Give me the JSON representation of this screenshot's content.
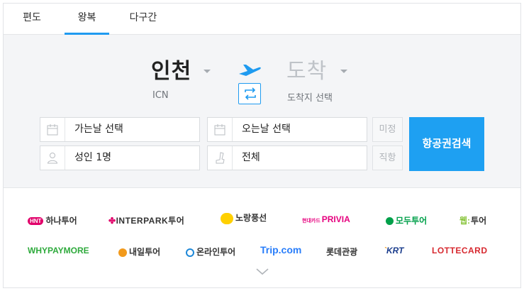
{
  "tabs": [
    {
      "label": "편도"
    },
    {
      "label": "왕복"
    },
    {
      "label": "다구간"
    }
  ],
  "active_tab": "왕복",
  "origin": {
    "name": "인천",
    "code": "ICN"
  },
  "destination": {
    "name": "도착",
    "code": "도착지 선택"
  },
  "fields": {
    "depart_date": "가는날 선택",
    "return_date": "오는날 선택",
    "flex_label": "미정",
    "passengers": "성인 1명",
    "seat_class": "전체",
    "direct_label": "직항"
  },
  "search_button": "항공권검색",
  "partners": [
    {
      "text": "하나투어",
      "badge": "HNT",
      "color": "#333333",
      "badge_color": "#e1006a"
    },
    {
      "text": "INTERPARK투어",
      "color": "#333333"
    },
    {
      "text": "노랑풍선",
      "color": "#333333",
      "badge_color": "#ffd000"
    },
    {
      "text": "PRIVIA",
      "prefix": "현대카드",
      "color": "#e6007e"
    },
    {
      "text": "모두투어",
      "color": "#00a04a"
    },
    {
      "text": "투어",
      "prefix": "웹",
      "color": "#333333",
      "badge_color": "#8ac53e"
    },
    {
      "text": "WHYPAYMORE",
      "color": "#2eaa3c"
    },
    {
      "text": "내일투어",
      "color": "#333333",
      "badge_color": "#f29a1c"
    },
    {
      "text": "온라인투어",
      "color": "#333333",
      "badge_color": "#1e88d8"
    },
    {
      "text": "Trip.com",
      "color": "#287dfa"
    },
    {
      "text": "롯데관광",
      "color": "#333333"
    },
    {
      "text": "KRT",
      "color": "#1a3c8c"
    },
    {
      "text": "LOTTECARD",
      "color": "#d7282f"
    }
  ],
  "icons": [
    "calendar-icon",
    "person-icon",
    "seat-icon",
    "plane-icon",
    "swap-icon",
    "chevron-down-icon"
  ],
  "colors": {
    "accent": "#1ea0f2",
    "panel_bg": "#f4f5f7"
  }
}
